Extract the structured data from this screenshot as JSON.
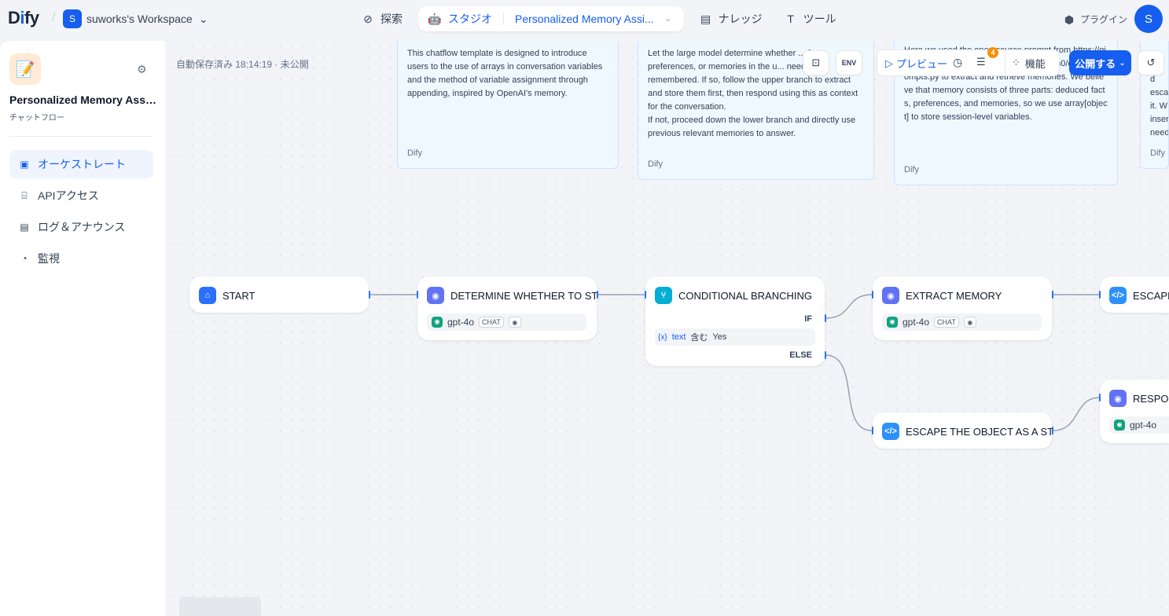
{
  "brand": {
    "logo_d": "D",
    "logo_i": "i",
    "logo_fy": "fy"
  },
  "workspace": {
    "avatar": "S",
    "name": "suworks's Workspace"
  },
  "nav": {
    "explore": "探索",
    "studio": "スタジオ",
    "app_name": "Personalized Memory Assi...",
    "knowledge": "ナレッジ",
    "tools": "ツール"
  },
  "plugin": "プラグイン",
  "user": {
    "avatar": "S"
  },
  "sidebar": {
    "app_title": "Personalized Memory Assi...",
    "app_type": "チャットフロー",
    "items": [
      {
        "label": "オーケストレート"
      },
      {
        "label": "APIアクセス"
      },
      {
        "label": "ログ＆アナウンス"
      },
      {
        "label": "監視"
      }
    ]
  },
  "canvas": {
    "autosave": "自動保存済み 18:14:19 · 未公開",
    "notes": [
      {
        "text": "This chatflow template is designed to introduce users to the use of arrays in conversation variables and the method of variable assignment through appending, inspired by OpenAI's memory.",
        "source": "Dify"
      },
      {
        "text": "Let the large model determine whether ... facts, preferences, or memories in the u... need to be remembered. If so, follow the upper branch to extract and store them first, then respond using this as context for the conversation.\nIf not, proceed down the lower branch and directly use previous relevant memories to answer.",
        "source": "Dify"
      },
      {
        "text": "Here we used the open source prompt from https://github.com/mem0ai/mem0/blob/main/mem0/configs/prompts.py to extract and retrieve memories. We believe that memory consists of three parts: deduced facts, preferences, and memories, so we use array[object] to store session-level variables.",
        "source": "Dify"
      },
      {
        "text": "t.\nd\nesca\nit. W\ninser\nneed",
        "source": "Dify"
      }
    ],
    "toolbar": {
      "env": "ENV",
      "preview": "プレビュー",
      "checklist_count": "4",
      "features": "機能",
      "publish": "公開する"
    },
    "nodes": {
      "start": {
        "title": "START"
      },
      "determine": {
        "title": "DETERMINE WHETHER TO STORE",
        "model": "gpt-4o",
        "tag": "CHAT"
      },
      "conditional": {
        "title": "CONDITIONAL BRANCHING",
        "if": "IF",
        "else": "ELSE",
        "cond_var": "text",
        "cond_op": "含む",
        "cond_value": "Yes",
        "var_icon": "{x}"
      },
      "extract": {
        "title": "EXTRACT MEMORY",
        "model": "gpt-4o",
        "tag": "CHAT"
      },
      "escape_top": {
        "title": "ESCAPE"
      },
      "escape_bottom": {
        "title": "ESCAPE THE OBJECT AS A STRING"
      },
      "response": {
        "title": "RESPONSE",
        "model": "gpt-4o"
      }
    }
  },
  "colors": {
    "accent": "#155eef",
    "llm": "#6172f3",
    "code": "#2e90fa",
    "branch": "#06aed4",
    "start": "#2970ff"
  }
}
